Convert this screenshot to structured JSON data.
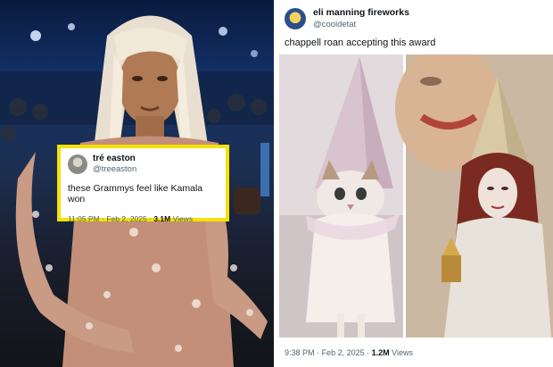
{
  "left_photo": {
    "image_icon": "woman-with-platinum-hair-photo"
  },
  "quoted_tweet": {
    "display_name": "tré easton",
    "handle": "@treeaston",
    "text": "these Grammys feel like Kamala won",
    "time": "11:05 PM",
    "separator": "·",
    "date": "Feb 2, 2025",
    "separator2": "·",
    "views_count": "3.1M",
    "views_label": "Views",
    "border_color": "#f5e10a"
  },
  "main_tweet": {
    "display_name": "eli manning fireworks",
    "handle": "@cooldetat",
    "text": "chappell roan accepting this award",
    "images": [
      "cat-in-wizard-hat-photo",
      "performer-in-cone-hat-photo"
    ],
    "time": "9:38 PM",
    "separator": "·",
    "date": "Feb 2, 2025",
    "separator2": "·",
    "views_count": "1.2M",
    "views_label": "Views"
  }
}
